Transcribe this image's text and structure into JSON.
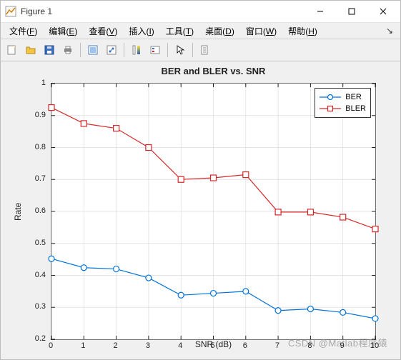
{
  "window": {
    "title": "Figure 1"
  },
  "menu": {
    "file": {
      "label": "文件",
      "accel": "F"
    },
    "edit": {
      "label": "编辑",
      "accel": "E"
    },
    "view": {
      "label": "查看",
      "accel": "V"
    },
    "insert": {
      "label": "插入",
      "accel": "I"
    },
    "tools": {
      "label": "工具",
      "accel": "T"
    },
    "desktop": {
      "label": "桌面",
      "accel": "D"
    },
    "window": {
      "label": "窗口",
      "accel": "W"
    },
    "help": {
      "label": "帮助",
      "accel": "H"
    }
  },
  "toolbar_icons": {
    "new": "new-figure",
    "open": "open",
    "save": "save",
    "print": "print",
    "data_cursor": "edit-plot",
    "link": "link",
    "colorbar": "colorbar",
    "legend": "legend",
    "pointer": "pointer",
    "insert": "insert"
  },
  "chart_data": {
    "type": "line",
    "title": "BER and BLER vs. SNR",
    "xlabel": "SNR (dB)",
    "ylabel": "Rate",
    "x": [
      0,
      1,
      2,
      3,
      4,
      5,
      6,
      7,
      8,
      9,
      10
    ],
    "xlim": [
      0,
      10
    ],
    "ylim": [
      0.2,
      1.0
    ],
    "xticks": [
      0,
      1,
      2,
      3,
      4,
      5,
      6,
      7,
      8,
      9,
      10
    ],
    "yticks": [
      0.2,
      0.3,
      0.4,
      0.5,
      0.6,
      0.7,
      0.8,
      0.9,
      1.0
    ],
    "grid": true,
    "legend_position": "northeast",
    "series": [
      {
        "name": "BER",
        "color": "#0072d9",
        "marker": "circle",
        "values": [
          0.452,
          0.424,
          0.42,
          0.392,
          0.338,
          0.344,
          0.35,
          0.29,
          0.295,
          0.284,
          0.265
        ]
      },
      {
        "name": "BLER",
        "color": "#d62728",
        "marker": "square",
        "values": [
          0.925,
          0.875,
          0.86,
          0.8,
          0.7,
          0.705,
          0.715,
          0.598,
          0.598,
          0.582,
          0.545
        ]
      }
    ]
  },
  "watermark": "CSDN @Matlab程序猿"
}
